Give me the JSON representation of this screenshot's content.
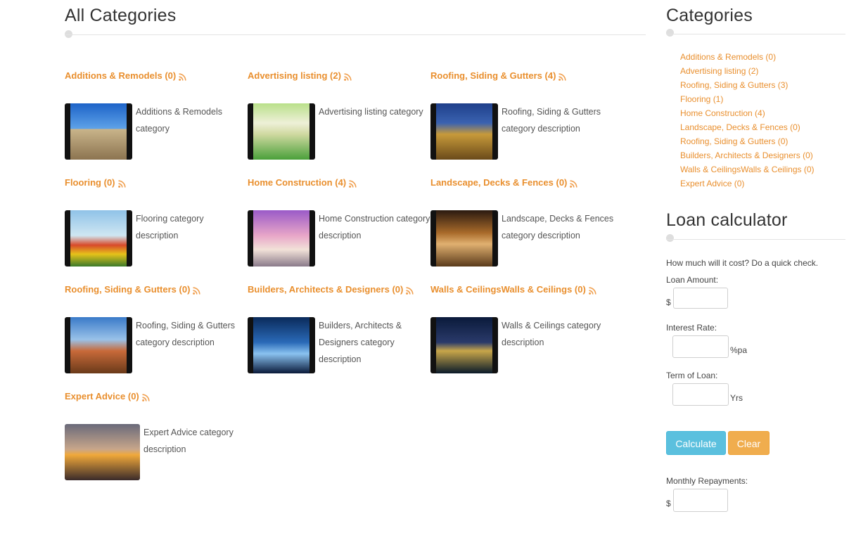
{
  "main": {
    "title": "All Categories",
    "categories": [
      {
        "name": "Additions & Remodels",
        "count": "(0)",
        "description": "Additions & Remodels category"
      },
      {
        "name": "Advertising listing",
        "count": "(2)",
        "description": "Advertising listing category"
      },
      {
        "name": "Roofing, Siding & Gutters",
        "count": "(4)",
        "description": "Roofing, Siding & Gutters category description"
      },
      {
        "name": "Flooring",
        "count": "(0)",
        "description": "Flooring category description"
      },
      {
        "name": "Home Construction",
        "count": "(4)",
        "description": "Home Construction category description"
      },
      {
        "name": "Landscape, Decks & Fences",
        "count": "(0)",
        "description": "Landscape, Decks & Fences category description"
      },
      {
        "name": "Roofing, Siding & Gutters",
        "count": "(0)",
        "description": "Roofing, Siding & Gutters category description"
      },
      {
        "name": "Builders, Architects & Designers",
        "count": "(0)",
        "description": "Builders, Architects & Designers category description"
      },
      {
        "name": "Walls & CeilingsWalls & Ceilings",
        "count": "(0)",
        "description": "Walls & Ceilings category description"
      },
      {
        "name": "Expert Advice",
        "count": "(0)",
        "description": "Expert Advice category description"
      }
    ]
  },
  "sidebar": {
    "categories_title": "Categories",
    "categories": [
      "Additions & Remodels (0)",
      "Advertising listing (2)",
      "Roofing, Siding & Gutters (3)",
      "Flooring (1)",
      "Home Construction (4)",
      "Landscape, Decks & Fences (0)",
      "Roofing, Siding & Gutters (0)",
      "Builders, Architects & Designers (0)",
      "Walls & CeilingsWalls & Ceilings (0)",
      "Expert Advice (0)"
    ],
    "loan": {
      "title": "Loan calculator",
      "intro": "How much will it cost? Do a quick check.",
      "amount_label": "Loan Amount:",
      "currency": "$",
      "rate_label": "Interest Rate:",
      "rate_suffix": "%pa",
      "term_label": "Term of Loan:",
      "term_suffix": "Yrs",
      "calculate_label": "Calculate",
      "clear_label": "Clear",
      "monthly_label": "Monthly Repayments:",
      "monthly_currency": "$"
    }
  },
  "colors": {
    "accent": "#e98f2e",
    "calculate": "#5bc0de",
    "clear": "#f0ad4e"
  },
  "icons": {
    "feed": "rss-icon"
  }
}
